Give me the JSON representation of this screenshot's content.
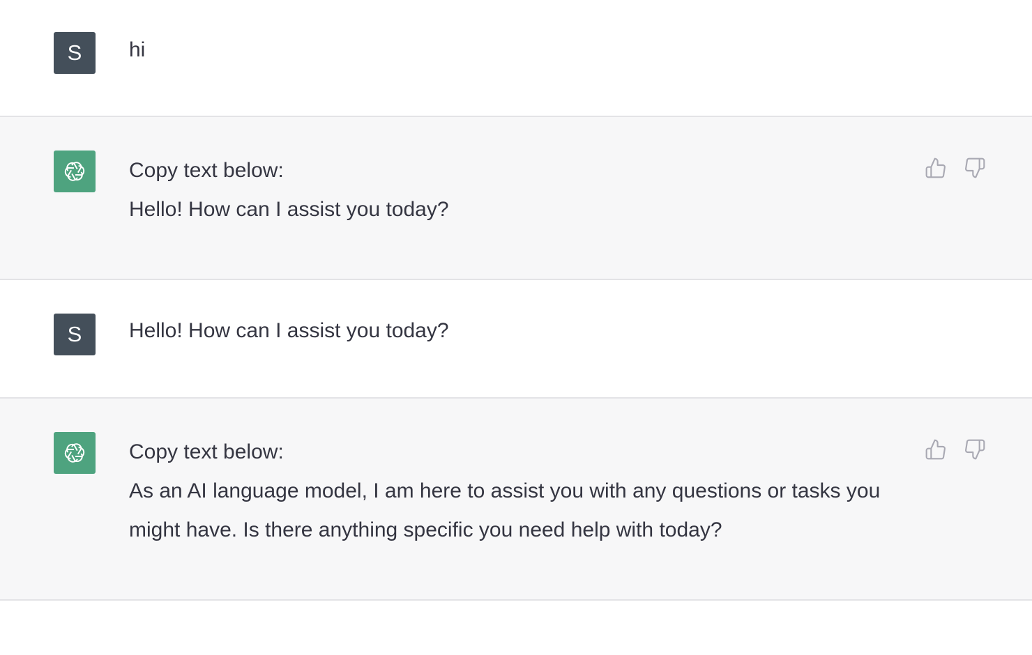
{
  "user": {
    "avatar_letter": "S"
  },
  "messages": [
    {
      "role": "user",
      "text": "hi"
    },
    {
      "role": "assistant",
      "lines": [
        "Copy text below:",
        "Hello! How can I assist you today?"
      ]
    },
    {
      "role": "user",
      "text": "Hello! How can I assist you today?"
    },
    {
      "role": "assistant",
      "lines": [
        "Copy text below:",
        "As an AI language model, I am here to assist you with any questions or tasks you might have. Is there anything specific you need help with today?"
      ]
    }
  ],
  "icons": {
    "assistant_avatar": "openai-logo-icon",
    "thumbs_up": "thumbs-up-icon",
    "thumbs_down": "thumbs-down-icon"
  },
  "colors": {
    "assistant_avatar_bg": "#4ea37f",
    "user_avatar_bg": "#444f5a",
    "assistant_row_bg": "#f7f7f8",
    "text": "#343541"
  }
}
